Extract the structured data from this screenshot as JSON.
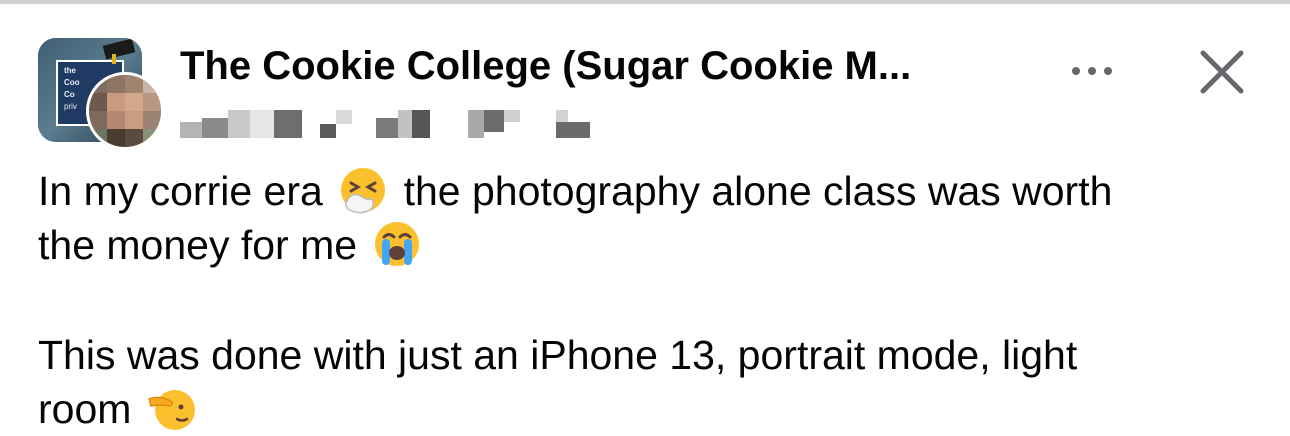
{
  "header": {
    "group_name": "The Cookie College (Sugar Cookie M...",
    "avatar_caption_1": "the",
    "avatar_caption_2": "Coo",
    "avatar_caption_3": "Co",
    "avatar_caption_4": "priv"
  },
  "actions": {
    "more_icon": "more-horizontal-icon",
    "close_icon": "close-icon"
  },
  "post": {
    "line1_before": "In my corrie era ",
    "emoji1": "sneezing-face-icon",
    "line1_after": " the photography alone class was worth",
    "line2": "the money for me ",
    "emoji2": "loudly-crying-face-icon",
    "line3": "This was done with just an iPhone 13, portrait mode, light",
    "line4": "room ",
    "emoji3": "saluting-face-icon"
  },
  "colors": {
    "text": "#050505",
    "secondary": "#65676b",
    "divider": "#ced0d4"
  }
}
